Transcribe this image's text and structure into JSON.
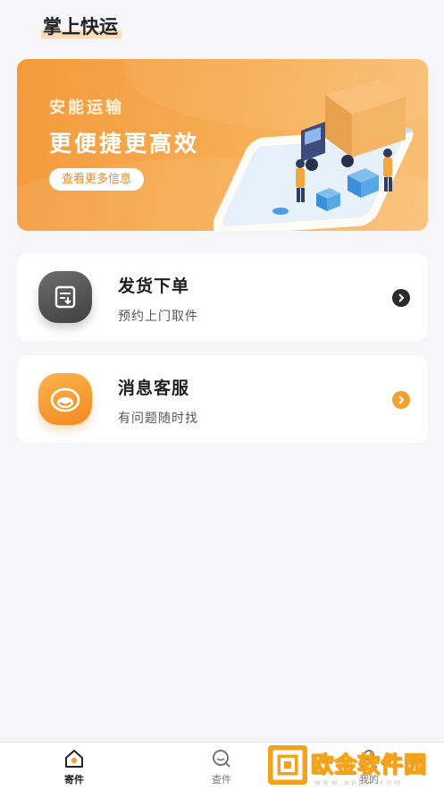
{
  "app": {
    "title": "掌上快运"
  },
  "banner": {
    "subtitle": "安能运输",
    "headline": "更便捷更高效",
    "button_label": "查看更多信息"
  },
  "cards": [
    {
      "title": "发货下单",
      "subtitle": "预约上门取件",
      "icon": "shipping-form-icon"
    },
    {
      "title": "消息客服",
      "subtitle": "有问题随时找",
      "icon": "customer-service-icon"
    }
  ],
  "tabbar": {
    "items": [
      {
        "label": "寄件",
        "icon": "home-icon",
        "active": true
      },
      {
        "label": "查件",
        "icon": "search-icon",
        "active": false
      },
      {
        "label": "我的",
        "icon": "user-icon",
        "active": false
      }
    ]
  },
  "watermark": {
    "text": "欧金软件园",
    "url": "www.apjin.com"
  },
  "colors": {
    "accent": "#f3a12e",
    "banner": "#f7ae55",
    "background": "#f6f6f8"
  }
}
